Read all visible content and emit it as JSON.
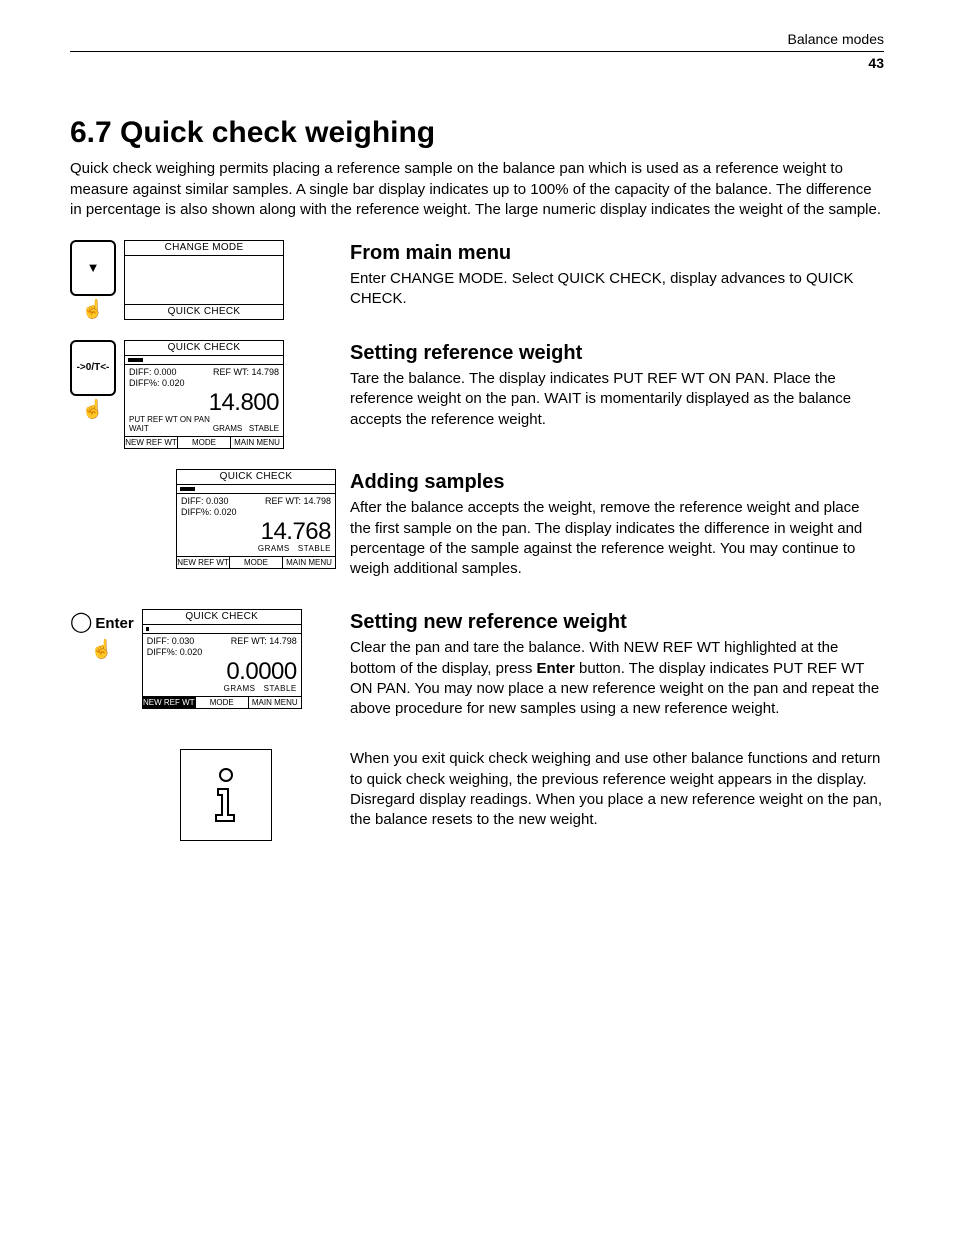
{
  "header": {
    "section": "Balance modes",
    "page": "43"
  },
  "title": "6.7  Quick check weighing",
  "intro": "Quick check weighing permits placing a reference sample on the balance pan which is used as a reference weight to measure against similar samples. A single bar display indicates up to 100% of the capacity of the balance. The difference in percentage is also shown along with the reference weight. The large numeric display indicates the weight of the sample.",
  "icons": {
    "tare": "->0/T<-",
    "enter": "Enter",
    "down": "▼"
  },
  "lcd1": {
    "title": "CHANGE MODE",
    "footer": "QUICK CHECK"
  },
  "lcd2": {
    "title": "QUICK CHECK",
    "diff": "DIFF: 0.000",
    "diffpct": "DIFF%: 0.020",
    "ref": "REF WT: 14.798",
    "put": "PUT REF WT ON PAN",
    "big": "14.800",
    "status_l": "WAIT",
    "status_m": "GRAMS",
    "status_r": "STABLE",
    "f1": "NEW REF WT",
    "f2": "MODE",
    "f3": "MAIN MENU"
  },
  "lcd3": {
    "title": "QUICK CHECK",
    "diff": "DIFF: 0.030",
    "diffpct": "DIFF%: 0.020",
    "ref": "REF WT: 14.798",
    "big": "14.768",
    "status_m": "GRAMS",
    "status_r": "STABLE",
    "f1": "NEW REF WT",
    "f2": "MODE",
    "f3": "MAIN MENU"
  },
  "lcd4": {
    "title": "QUICK CHECK",
    "diff": "DIFF: 0.030",
    "diffpct": "DIFF%: 0.020",
    "ref": "REF WT: 14.798",
    "big": "0.0000",
    "status_m": "GRAMS",
    "status_r": "STABLE",
    "f1": "NEW REF WT",
    "f2": "MODE",
    "f3": "MAIN MENU"
  },
  "sec1": {
    "h": "From main menu",
    "p": "Enter CHANGE MODE. Select QUICK CHECK, display advances to QUICK CHECK."
  },
  "sec2": {
    "h": "Setting reference weight",
    "p": "Tare the balance. The display indicates PUT REF WT ON PAN. Place the reference weight on the pan. WAIT is momentarily displayed as the balance accepts the reference weight."
  },
  "sec3": {
    "h": "Adding samples",
    "p": "After the balance accepts the weight, remove the reference weight and place the first sample on the pan. The display indicates the difference in weight and percentage of the sample against the reference weight. You may continue to weigh additional samples."
  },
  "sec4": {
    "h": "Setting new reference weight",
    "p1": "Clear the pan and tare the balance. With NEW REF WT highlighted at the bottom of the display, press ",
    "bold": "Enter",
    "p2": " button. The display indicates PUT REF WT ON PAN. You may now place a new reference weight on the pan and repeat the above procedure for new samples using a new reference weight."
  },
  "note": "When you exit quick check weighing and use other balance functions and return to quick check weighing, the previous reference weight appears in the display. Disregard display readings. When you place a new reference weight on the pan, the balance resets to the new weight."
}
